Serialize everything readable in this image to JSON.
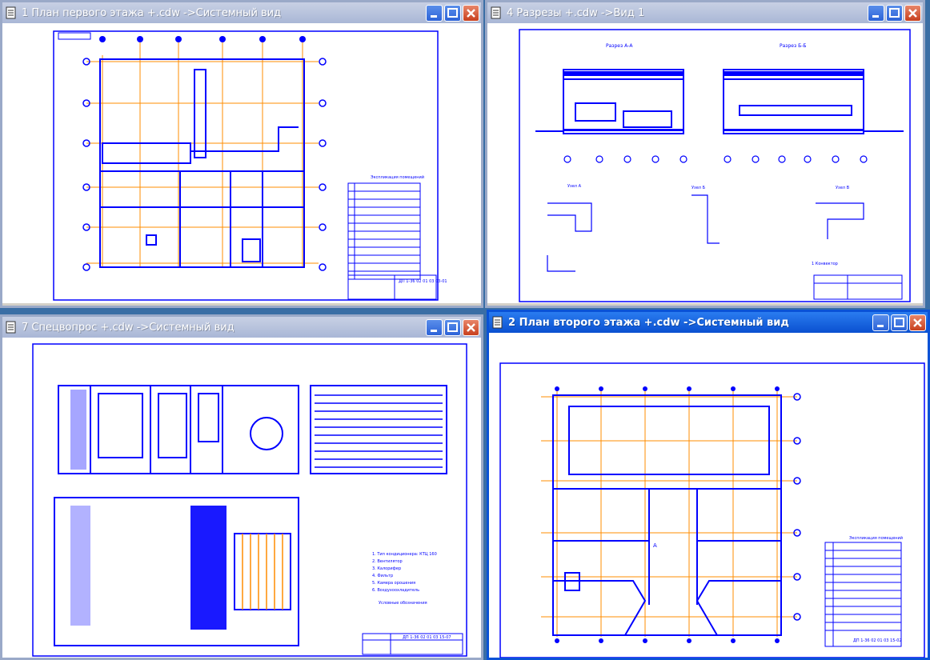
{
  "windows": [
    {
      "title": "1 План первого этажа +.cdw ->Системный вид",
      "active": false
    },
    {
      "title": "4 Разрезы +.cdw ->Вид 1",
      "active": false
    },
    {
      "title": "7 Спецвопрос +.cdw ->Системный вид",
      "active": false
    },
    {
      "title": "2 План второго этажа +.cdw ->Системный вид",
      "active": true
    }
  ],
  "colors": {
    "line": "#0000ff",
    "axis": "#ff8c00",
    "title_active": "#0a50d0",
    "title_inactive": "#a9b7d6",
    "close": "#c8401e"
  },
  "icons": [
    "document-icon",
    "minimize-icon",
    "maximize-icon",
    "close-icon"
  ],
  "drawings": {
    "w1": {
      "legend_title": "Экспликация помещений",
      "stamp": "ДП 1-36 02 01 03 03-01"
    },
    "w2": {
      "sect1": "Разрез А-А",
      "sect2": "Разрез Б-Б",
      "node1": "Узел А",
      "node2": "Узел Б",
      "node3": "Узел В",
      "caption": "1 Конвектор"
    },
    "w3": {
      "stamp": "ДП 1-36 02 01 03 15-07",
      "notes": [
        "1. Тип кондиционера: КТЦ 160",
        "2. Вентилятор",
        "3. Калорифер",
        "4. Фильтр",
        "5. Камера орошения",
        "6. Воздухоохладитель"
      ],
      "legend": "Условные обозначения"
    },
    "w4": {
      "legend_title": "Экспликация помещений",
      "stamp": "ДП 1-36 02 01 03 15-02",
      "mark": "А"
    }
  }
}
